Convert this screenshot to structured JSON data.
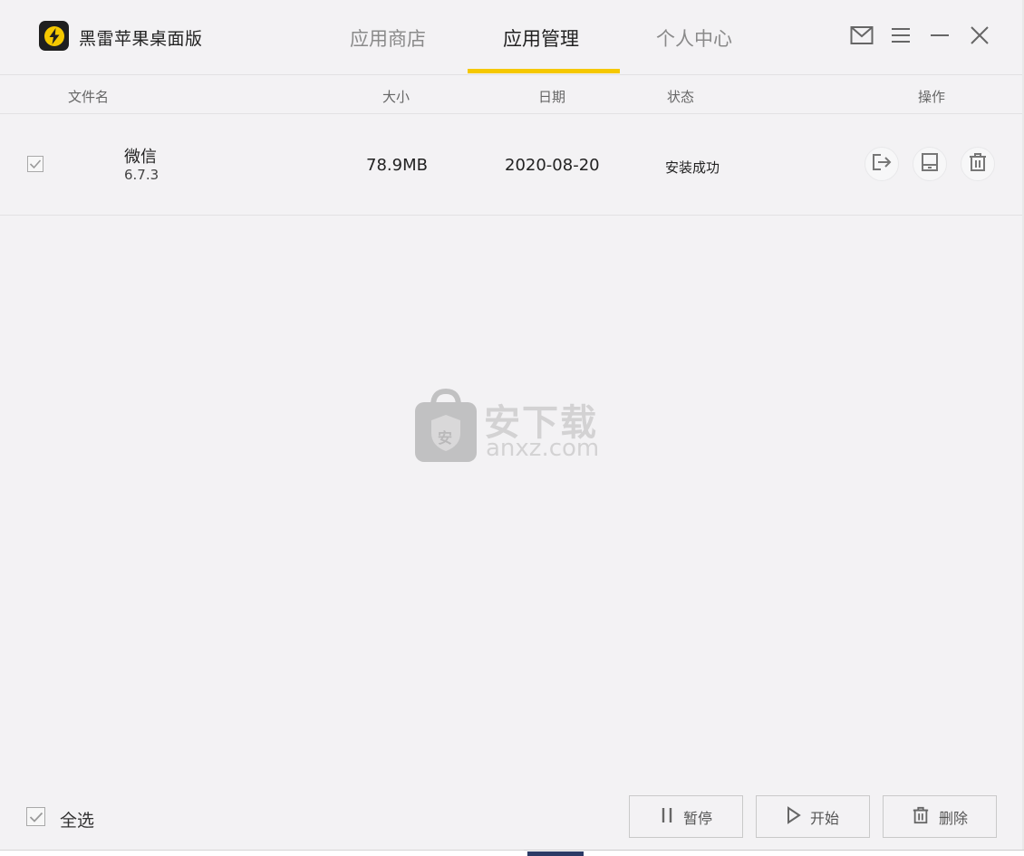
{
  "app": {
    "title": "黑雷苹果桌面版",
    "logo_icon": "lightning-bolt-icon",
    "accent_color": "#f5c800"
  },
  "tabs": [
    {
      "label": "应用商店",
      "active": false
    },
    {
      "label": "应用管理",
      "active": true
    },
    {
      "label": "个人中心",
      "active": false
    }
  ],
  "window_controls": [
    "mail-icon",
    "menu-icon",
    "minimize-icon",
    "close-icon"
  ],
  "table": {
    "columns": {
      "filename": "文件名",
      "size": "大小",
      "date": "日期",
      "status": "状态",
      "actions": "操作"
    },
    "rows": [
      {
        "checked": true,
        "name": "微信",
        "version": "6.7.3",
        "size": "78.9MB",
        "date": "2020-08-20",
        "status": "安装成功",
        "actions": [
          "export-icon",
          "install-icon",
          "trash-icon"
        ]
      }
    ]
  },
  "watermark": {
    "cn": "安下载",
    "en": "anxz.com",
    "badge": "安"
  },
  "footer": {
    "select_all_label": "全选",
    "select_all_checked": true,
    "pause_label": "暂停",
    "start_label": "开始",
    "delete_label": "删除"
  }
}
